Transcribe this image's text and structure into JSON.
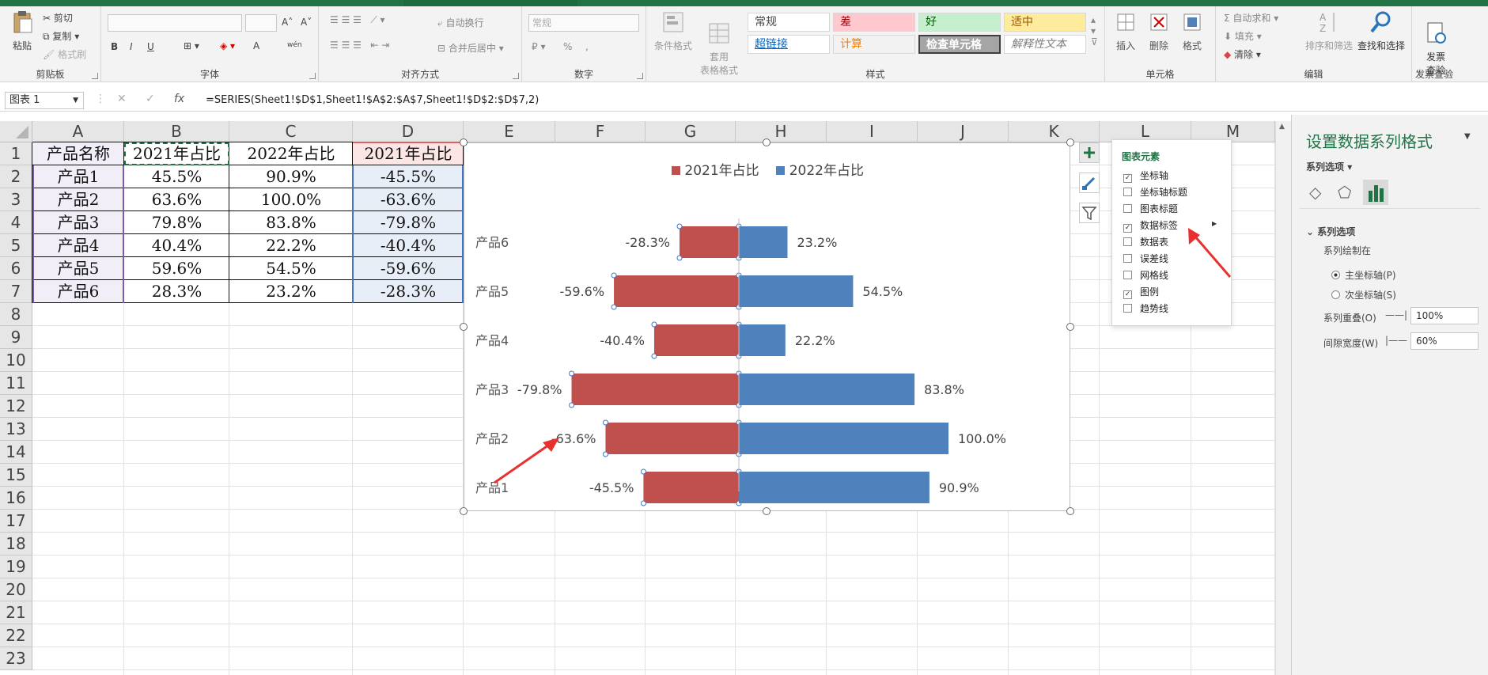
{
  "ribbon": {
    "clipboard": {
      "paste": "粘贴",
      "cut": "剪切",
      "copy": "复制",
      "format_painter": "格式刷",
      "label": "剪贴板"
    },
    "font": {
      "label": "字体",
      "bold": "B",
      "italic": "I",
      "underline": "U",
      "grow": "A˄",
      "shrink": "A˅",
      "color_a": "A",
      "phonetic": "wén"
    },
    "align": {
      "label": "对齐方式",
      "wrap": "自动换行",
      "merge": "合并后居中"
    },
    "number": {
      "label": "数字",
      "format": "常规",
      "percent": "%",
      "comma": ","
    },
    "styles": {
      "label": "样式",
      "cond": "条件格式",
      "table": "套用\n表格格式",
      "normal": "常规",
      "bad": "差",
      "good": "好",
      "neutral": "适中",
      "hyperlink": "超链接",
      "calc": "计算",
      "check": "检查单元格",
      "explain": "解释性文本"
    },
    "cells": {
      "label": "单元格",
      "insert": "插入",
      "delete": "删除",
      "format": "格式"
    },
    "editing": {
      "label": "编辑",
      "autosum": "自动求和",
      "fill": "填充",
      "clear": "清除",
      "sortfilter": "排序和筛选",
      "find": "查找和选择"
    },
    "invoice": {
      "label": "发票查验",
      "btn": "发票\n查验"
    }
  },
  "formula_bar": {
    "name_box": "图表 1",
    "fx": "fx",
    "formula": "=SERIES(Sheet1!$D$1,Sheet1!$A$2:$A$7,Sheet1!$D$2:$D$7,2)"
  },
  "sheet": {
    "columns": [
      "A",
      "B",
      "C",
      "D",
      "E",
      "F",
      "G",
      "H",
      "I",
      "J",
      "K",
      "L",
      "M"
    ],
    "rows": [
      "1",
      "2",
      "3",
      "4",
      "5",
      "6",
      "7",
      "8",
      "9",
      "10",
      "11",
      "12",
      "13",
      "14",
      "15",
      "16",
      "17",
      "18",
      "19",
      "20",
      "21",
      "22",
      "23"
    ],
    "header_row": [
      "产品名称",
      "2021年占比",
      "2022年占比",
      "2021年占比"
    ],
    "data": [
      [
        "产品1",
        "45.5%",
        "90.9%",
        "-45.5%"
      ],
      [
        "产品2",
        "63.6%",
        "100.0%",
        "-63.6%"
      ],
      [
        "产品3",
        "79.8%",
        "83.8%",
        "-79.8%"
      ],
      [
        "产品4",
        "40.4%",
        "22.2%",
        "-40.4%"
      ],
      [
        "产品5",
        "59.6%",
        "54.5%",
        "-59.6%"
      ],
      [
        "产品6",
        "28.3%",
        "23.2%",
        "-28.3%"
      ]
    ]
  },
  "chart_data": {
    "type": "bar",
    "orientation": "horizontal",
    "categories": [
      "产品1",
      "产品2",
      "产品3",
      "产品4",
      "产品5",
      "产品6"
    ],
    "series": [
      {
        "name": "2021年占比",
        "values": [
          -45.5,
          -63.6,
          -79.8,
          -40.4,
          -59.6,
          -28.3
        ],
        "color": "#c0504d",
        "labels": [
          "-45.5%",
          "-63.6%",
          "-79.8%",
          "-40.4%",
          "-59.6%",
          "-28.3%"
        ]
      },
      {
        "name": "2022年占比",
        "values": [
          90.9,
          100.0,
          83.8,
          22.2,
          54.5,
          23.2
        ],
        "color": "#4f81bd",
        "labels": [
          "90.9%",
          "100.0%",
          "83.8%",
          "22.2%",
          "54.5%",
          "23.2%"
        ]
      }
    ],
    "legend": "top",
    "overlap": "100%",
    "gap_width": "60%"
  },
  "chart_elements_popup": {
    "title": "图表元素",
    "items": [
      {
        "label": "坐标轴",
        "checked": true
      },
      {
        "label": "坐标轴标题",
        "checked": false
      },
      {
        "label": "图表标题",
        "checked": false
      },
      {
        "label": "数据标签",
        "checked": true
      },
      {
        "label": "数据表",
        "checked": false
      },
      {
        "label": "误差线",
        "checked": false
      },
      {
        "label": "网格线",
        "checked": false
      },
      {
        "label": "图例",
        "checked": true
      },
      {
        "label": "趋势线",
        "checked": false
      }
    ]
  },
  "format_pane": {
    "title": "设置数据系列格式",
    "options_dropdown": "系列选项",
    "section": "系列选项",
    "plot_on": "系列绘制在",
    "primary": "主坐标轴(P)",
    "secondary": "次坐标轴(S)",
    "overlap_label": "系列重叠(O)",
    "overlap_value": "100%",
    "gap_label": "间隙宽度(W)",
    "gap_value": "60%"
  },
  "colors": {
    "accent": "#217346",
    "red": "#c0504d",
    "blue": "#4f81bd",
    "arrow": "#e8312f"
  }
}
